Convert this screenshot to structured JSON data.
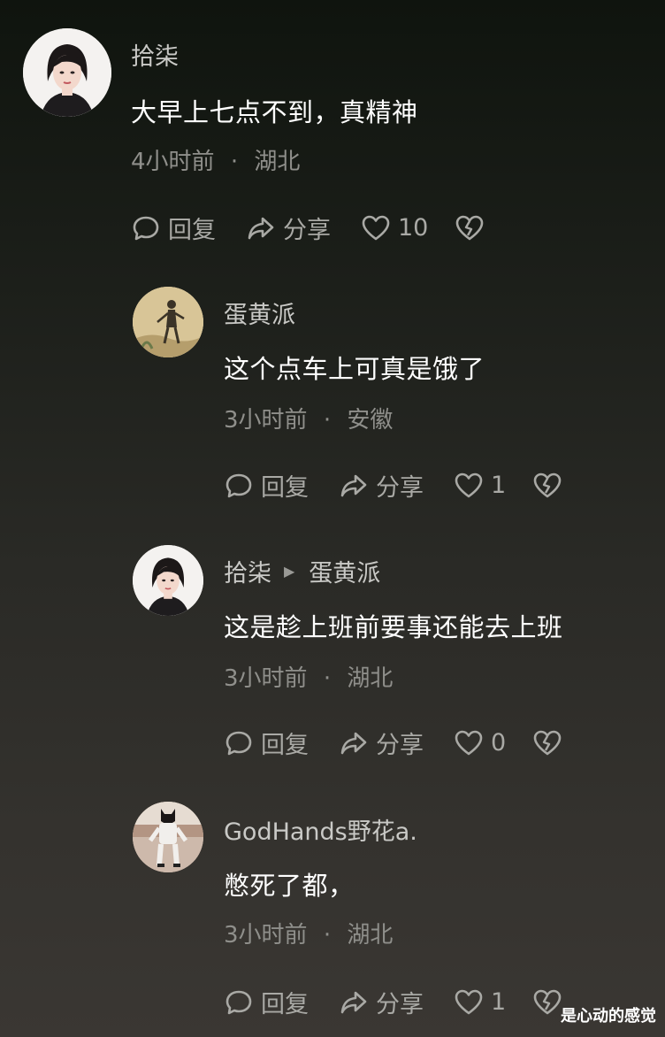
{
  "comments": [
    {
      "user": "拾柒",
      "text": "大早上七点不到，真精神",
      "time": "4小时前",
      "location": "湖北",
      "reply_label": "回复",
      "share_label": "分享",
      "likes": "10"
    },
    {
      "user": "蛋黄派",
      "text": "这个点车上可真是饿了",
      "time": "3小时前",
      "location": "安徽",
      "reply_label": "回复",
      "share_label": "分享",
      "likes": "1"
    },
    {
      "user": "拾柒",
      "reply_to": "蛋黄派",
      "text": "这是趁上班前要事还能去上班",
      "time": "3小时前",
      "location": "湖北",
      "reply_label": "回复",
      "share_label": "分享",
      "likes": "0"
    },
    {
      "user": "GodHands野花a.",
      "text": "憋死了都，",
      "time": "3小时前",
      "location": "湖北",
      "reply_label": "回复",
      "share_label": "分享",
      "likes": "1"
    }
  ],
  "meta_separator": "·",
  "watermark": "是心动的感觉",
  "icons": {
    "reply": "reply-bubble-icon",
    "share": "share-arrow-icon",
    "like": "heart-outline-icon",
    "dislike": "broken-heart-icon"
  },
  "colors": {
    "name": "#c9c9c6",
    "text": "#ffffff",
    "meta": "#8f8f8b",
    "action": "#a9a9a5"
  }
}
